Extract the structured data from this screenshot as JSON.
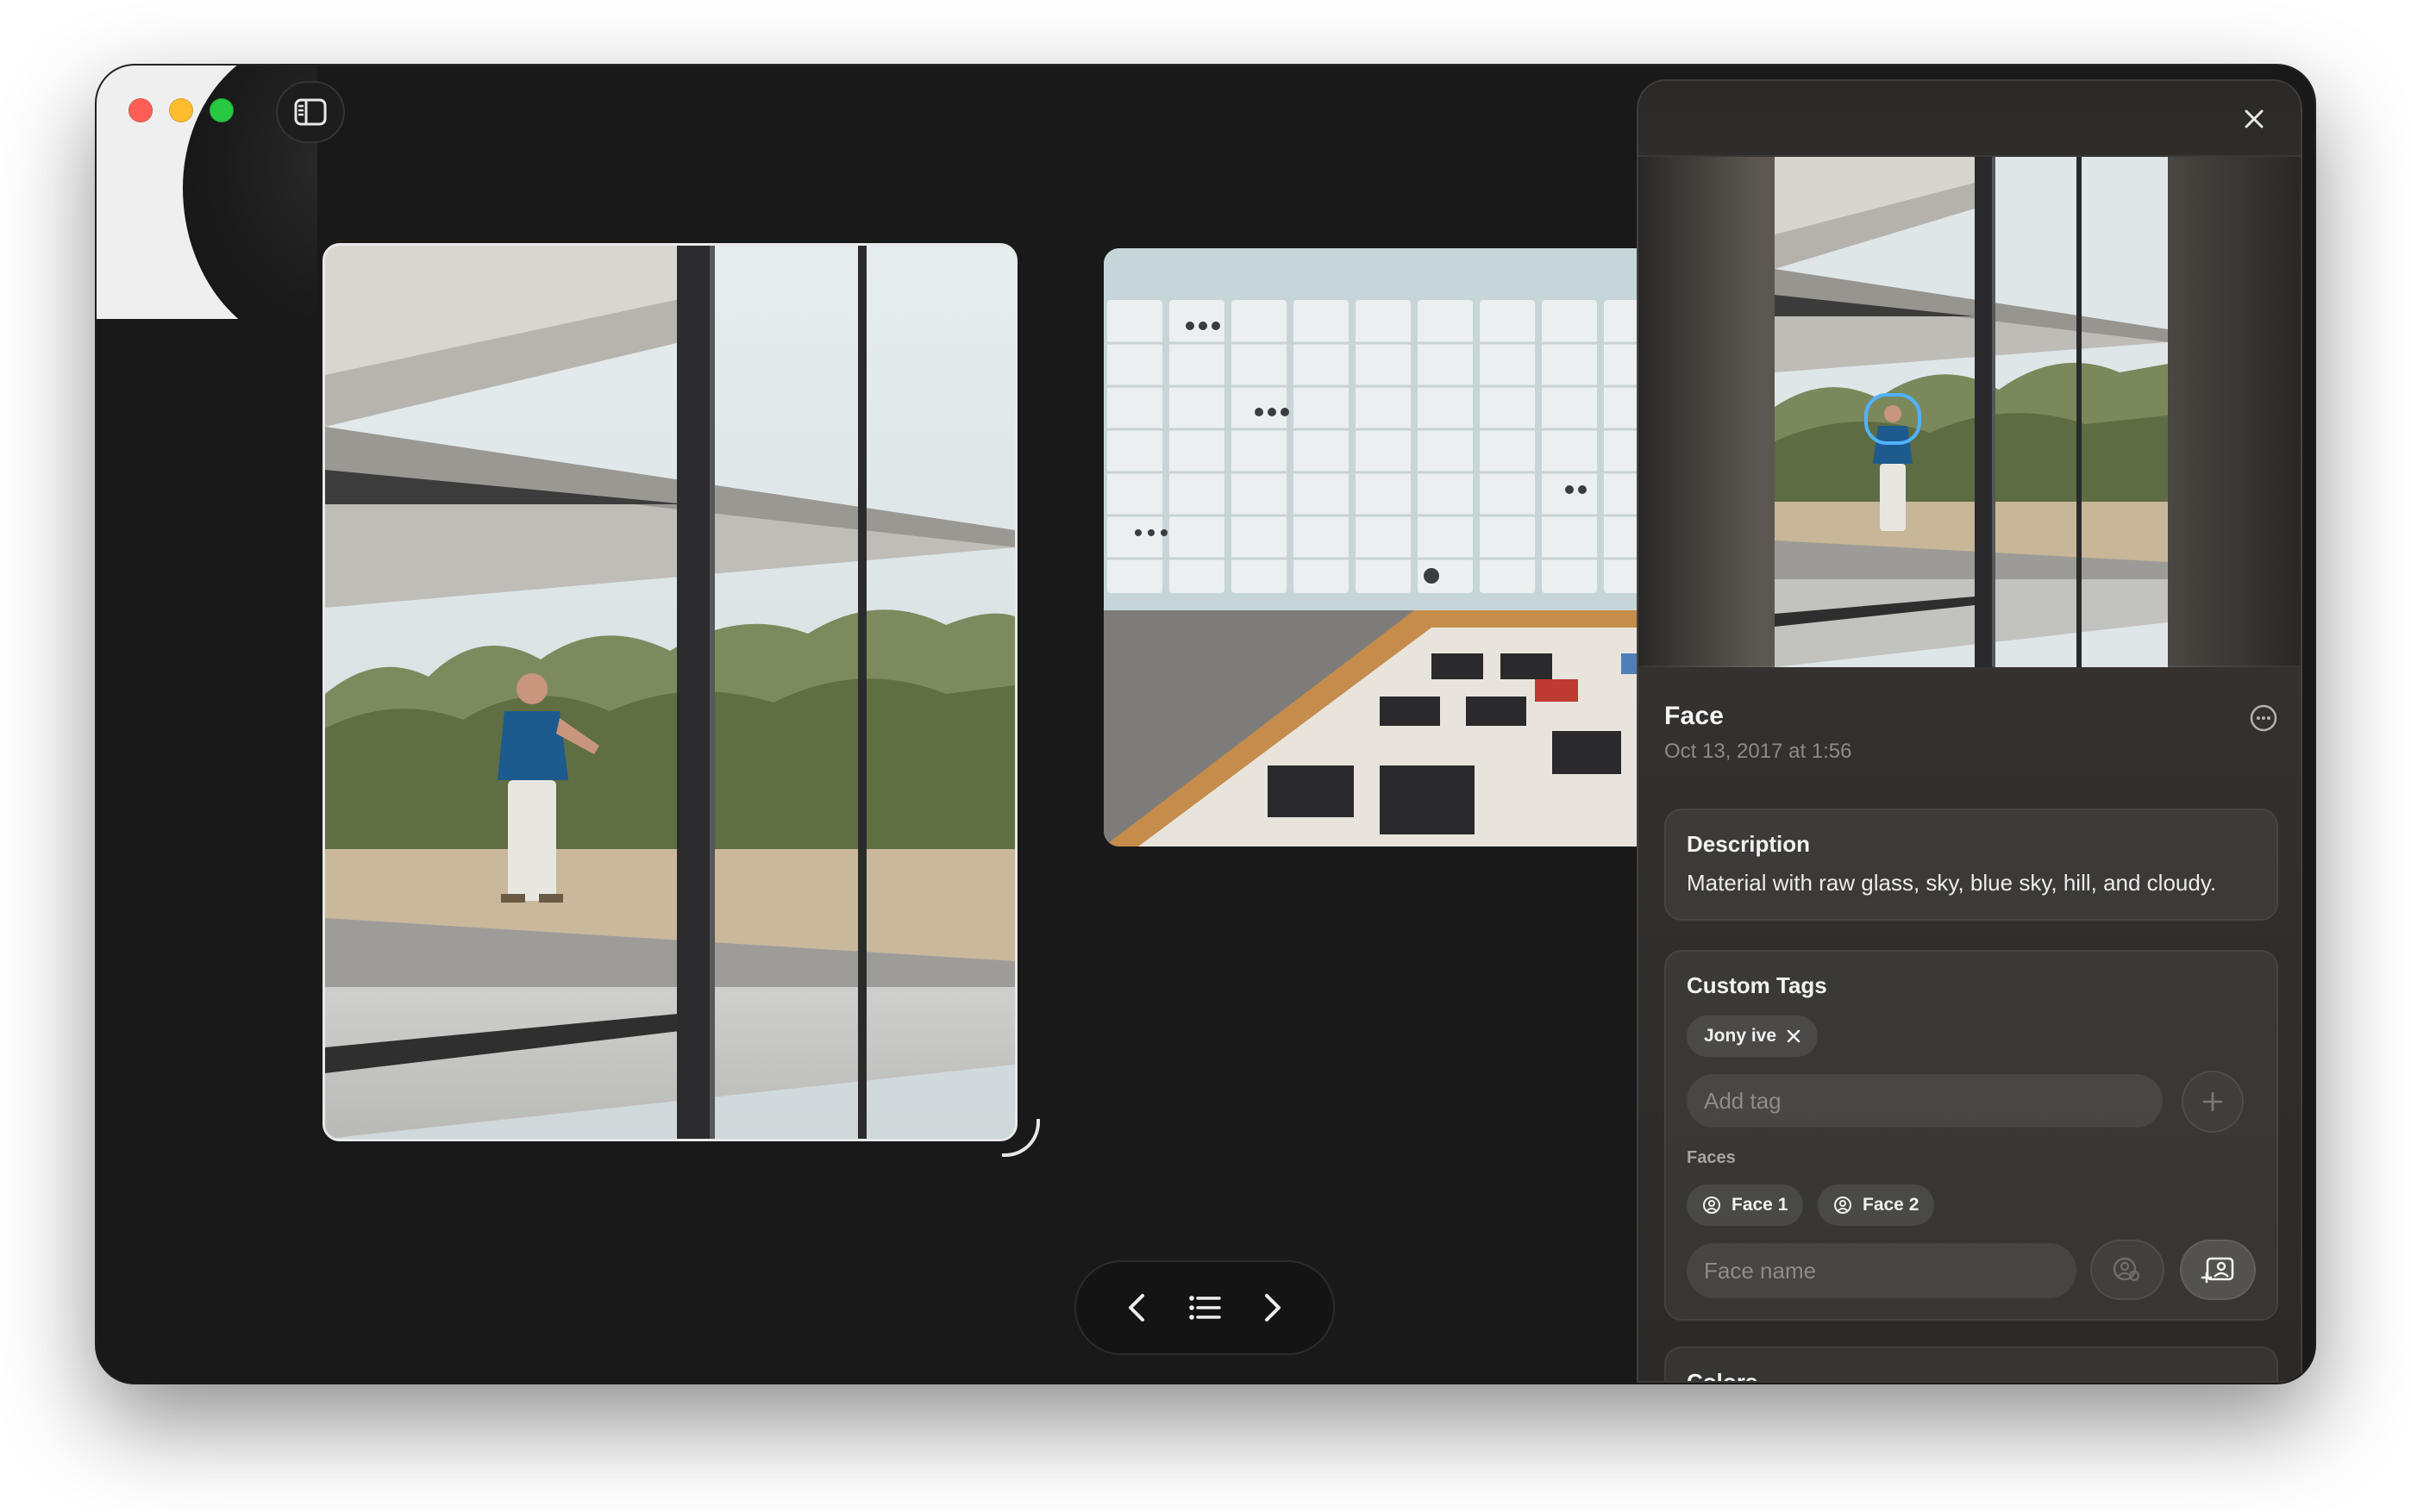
{
  "window": {
    "sidebar_toggle_icon": "sidebar-icon"
  },
  "inspector": {
    "title": "Face",
    "date": "Oct 13, 2017 at 1:56",
    "description": {
      "heading": "Description",
      "text": "Material with raw glass, sky, blue sky, hill, and cloudy."
    },
    "custom_tags": {
      "heading": "Custom Tags",
      "tags": [
        {
          "label": "Jony ive"
        }
      ],
      "add_placeholder": "Add tag"
    },
    "faces": {
      "heading": "Faces",
      "items": [
        {
          "label": "Face 1"
        },
        {
          "label": "Face 2"
        }
      ],
      "name_placeholder": "Face name"
    },
    "colors": {
      "heading": "Colors"
    }
  },
  "nav": {
    "prev_icon": "chevron-left-icon",
    "list_icon": "list-icon",
    "next_icon": "chevron-right-icon"
  },
  "accent": "#4fb3ff"
}
